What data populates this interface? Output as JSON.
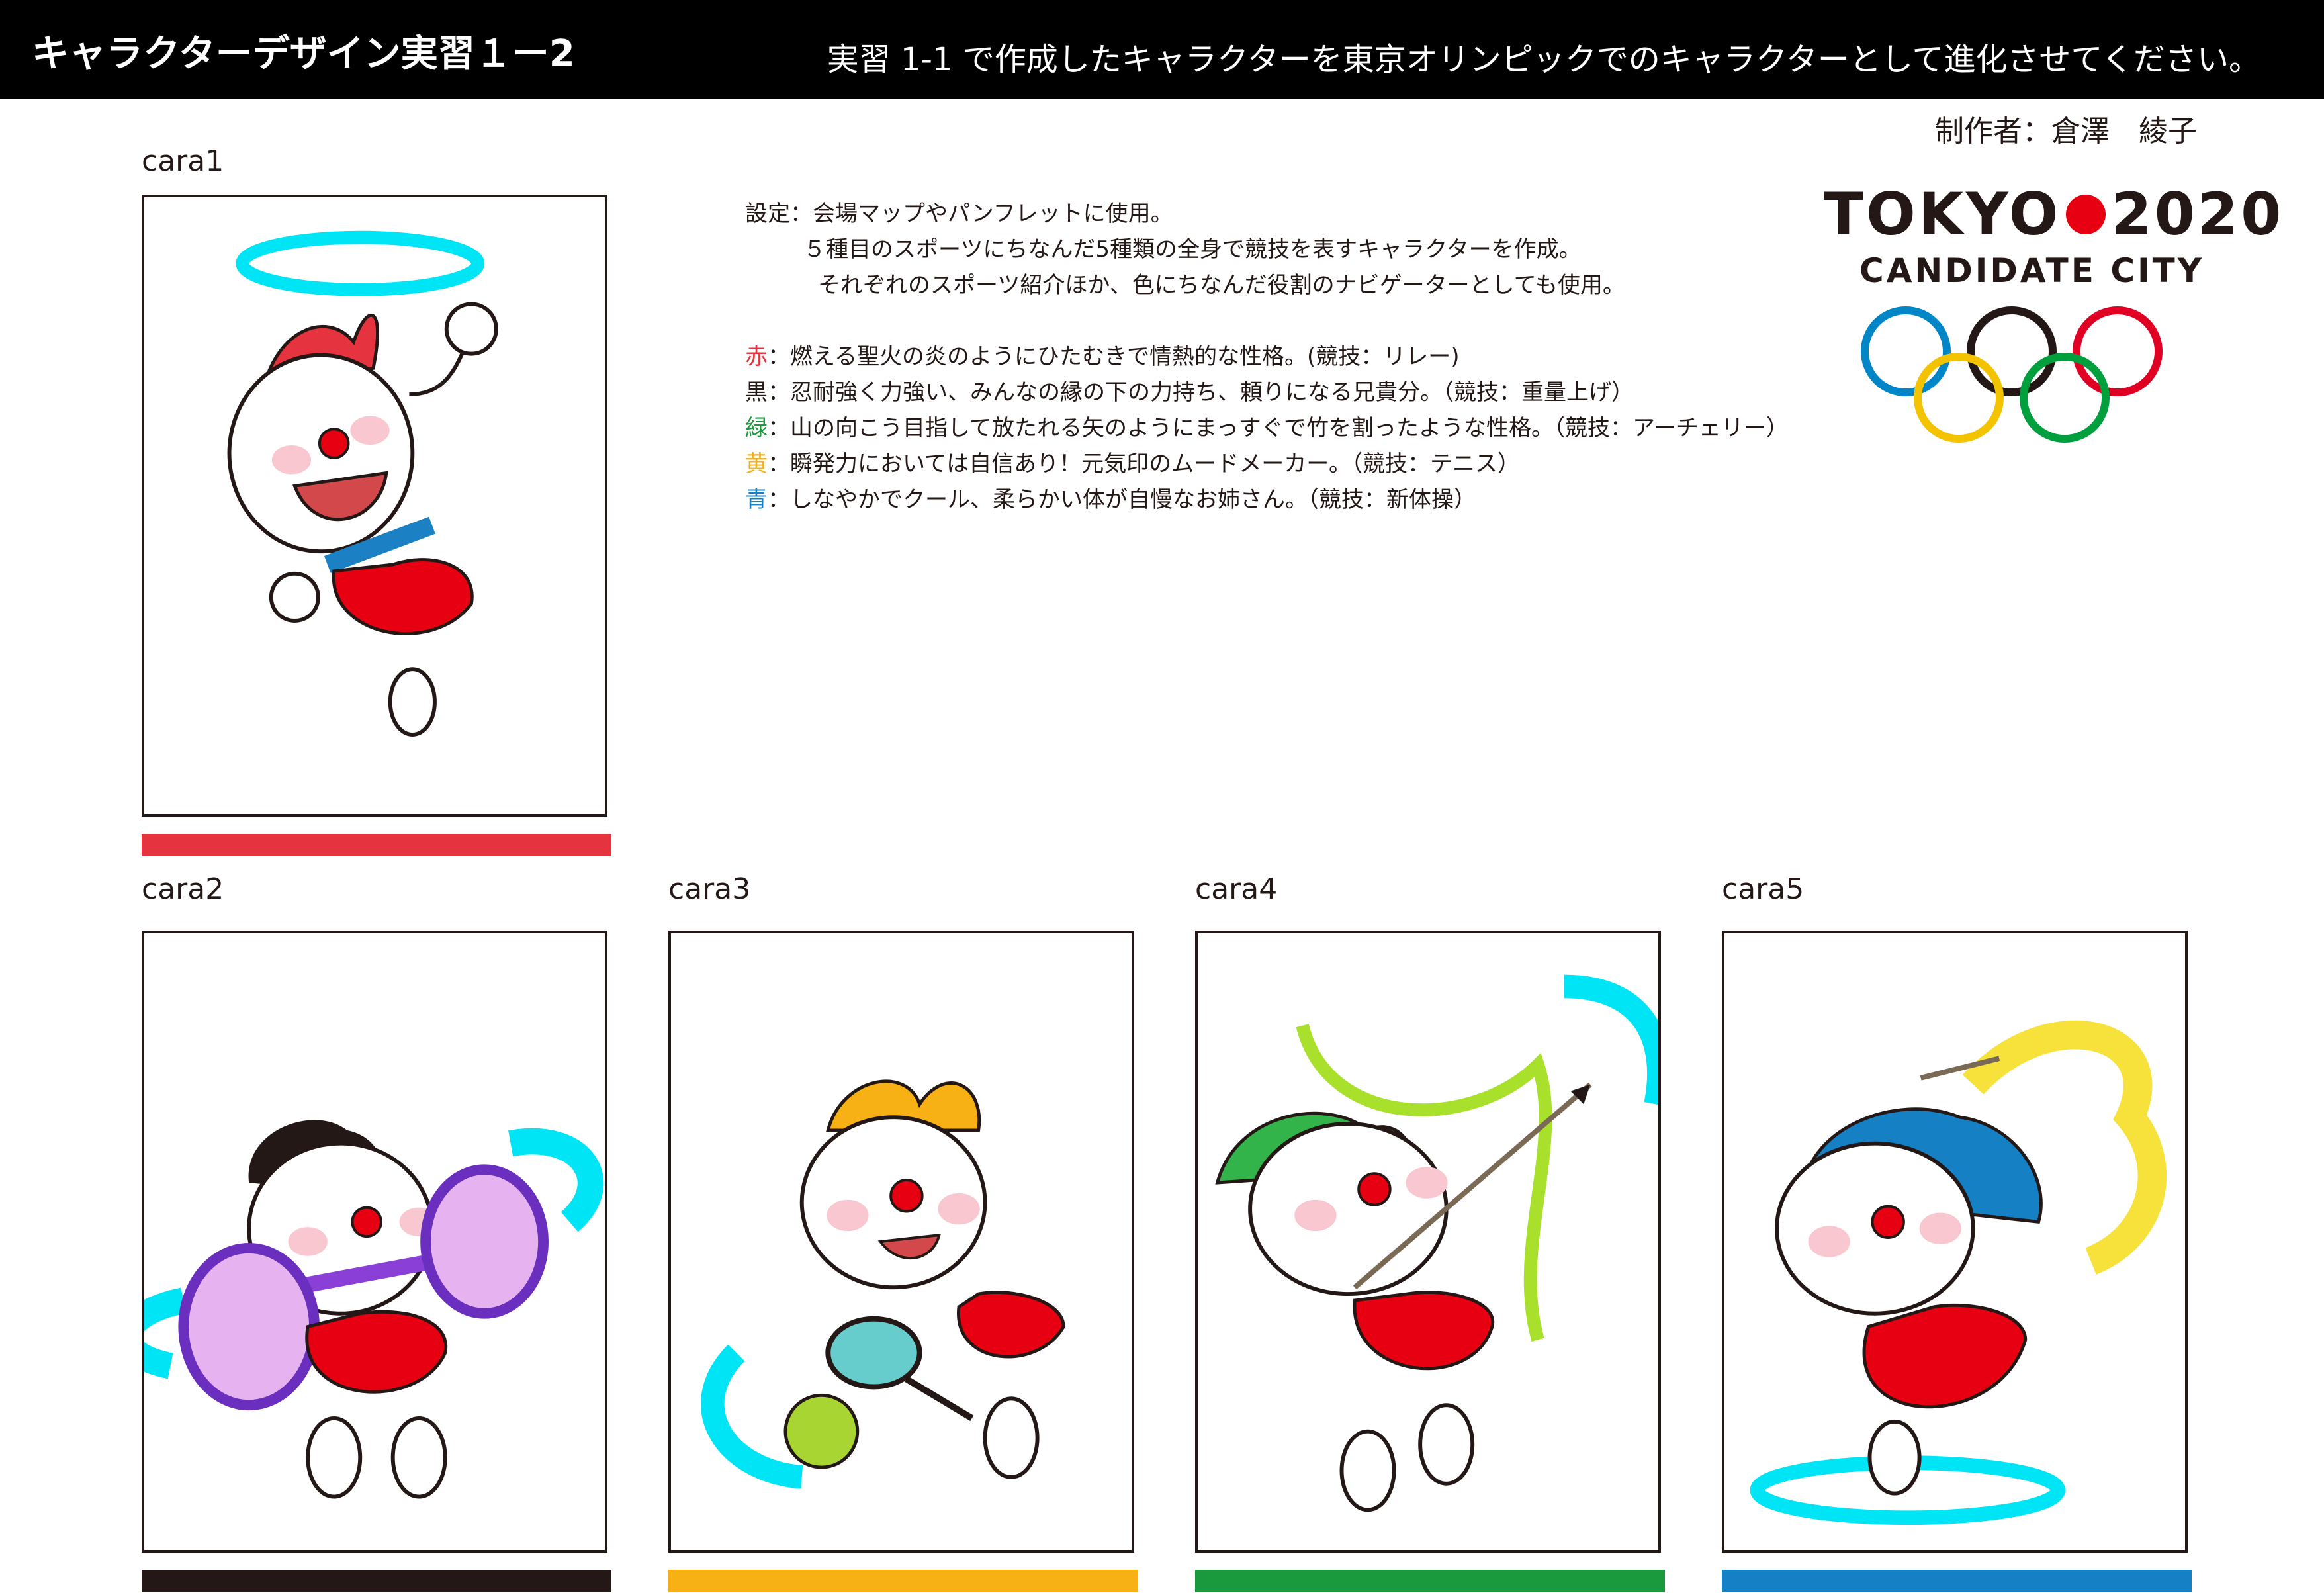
{
  "header": {
    "title": "キャラクターデザイン実習１ー2",
    "task": "実習 1-1 で作成したキャラクターを東京オリンピックでのキャラクターとして進化させてください。"
  },
  "author": "制作者：倉澤　綾子",
  "settings": {
    "line1": "設定：会場マップやパンフレットに使用。",
    "line2": "５種目のスポーツにちなんだ5種類の全身で競技を表すキャラクターを作成。",
    "line3": "それぞれのスポーツ紹介ほか、色にちなんだ役割のナビゲーターとしても使用。",
    "roles": [
      {
        "key": "赤",
        "color": "#e5343f",
        "text": "：燃える聖火の炎のようにひたむきで情熱的な性格。(競技：リレー)"
      },
      {
        "key": "黒",
        "color": "#231815",
        "text": "：忍耐強く力強い、みんなの縁の下の力持ち、頼りになる兄貴分。（競技：重量上げ）"
      },
      {
        "key": "緑",
        "color": "#1a9a3c",
        "text": "：山の向こう目指して放たれる矢のようにまっすぐで竹を割ったような性格。（競技：アーチェリー）"
      },
      {
        "key": "黄",
        "color": "#f2b01e",
        "text": "：瞬発力においては自信あり！元気印のムードメーカー。（競技：テニス）"
      },
      {
        "key": "青",
        "color": "#1580c4",
        "text": "：しなやかでクール、柔らかい体が自慢なお姉さん。（競技：新体操）"
      }
    ]
  },
  "logo": {
    "left": "TOKYO",
    "right": "2020",
    "sub": "CANDIDATE CITY",
    "dot_color": "#e60012",
    "ring_colors": [
      "#0085c7",
      "#231815",
      "#df0024",
      "#f4c300",
      "#009f3d"
    ]
  },
  "cards": [
    {
      "label": "cara1",
      "bar_color": "#e5343f",
      "icon": "relay-character"
    },
    {
      "label": "cara2",
      "bar_color": "#231815",
      "icon": "weightlifting-character"
    },
    {
      "label": "cara3",
      "bar_color": "#f7b114",
      "icon": "tennis-character"
    },
    {
      "label": "cara4",
      "bar_color": "#1a9a3c",
      "icon": "archery-character"
    },
    {
      "label": "cara5",
      "bar_color": "#1580c4",
      "icon": "gymnastics-character"
    }
  ]
}
